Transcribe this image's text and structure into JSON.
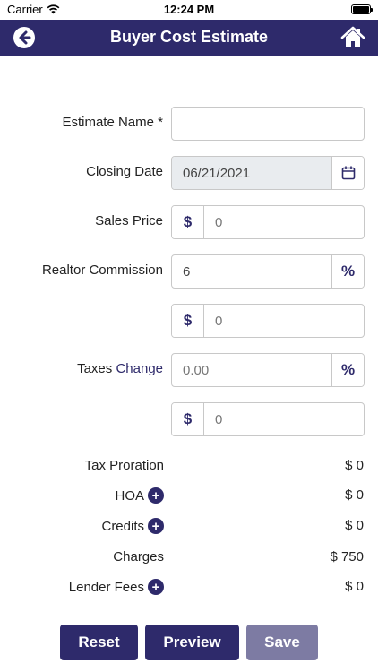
{
  "status": {
    "carrier": "Carrier",
    "time": "12:24 PM"
  },
  "header": {
    "title": "Buyer Cost Estimate",
    "back_icon": "back-arrow-icon",
    "home_icon": "home-icon"
  },
  "form": {
    "estimate_name": {
      "label": "Estimate Name *",
      "value": ""
    },
    "closing_date": {
      "label": "Closing Date",
      "value": "06/21/2021"
    },
    "sales_price": {
      "label": "Sales Price",
      "prefix": "$",
      "placeholder": "0"
    },
    "realtor_commission": {
      "label": "Realtor Commission",
      "value": "6",
      "suffix": "%",
      "amount_prefix": "$",
      "amount_placeholder": "0"
    },
    "taxes": {
      "label": "Taxes",
      "link": "Change",
      "placeholder": "0.00",
      "suffix": "%",
      "amount_prefix": "$",
      "amount_placeholder": "0"
    }
  },
  "summary": [
    {
      "label": "Tax Proration",
      "value": "$ 0",
      "addable": false
    },
    {
      "label": "HOA",
      "value": "$ 0",
      "addable": true
    },
    {
      "label": "Credits",
      "value": "$ 0",
      "addable": true
    },
    {
      "label": "Charges",
      "value": "$ 750",
      "addable": false
    },
    {
      "label": "Lender Fees",
      "value": "$ 0",
      "addable": true
    }
  ],
  "footer": {
    "reset": "Reset",
    "preview": "Preview",
    "save": "Save"
  },
  "colors": {
    "primary": "#2e2a6b",
    "disabled_button": "#7d7ba3",
    "readonly_field": "#e9ecef"
  }
}
